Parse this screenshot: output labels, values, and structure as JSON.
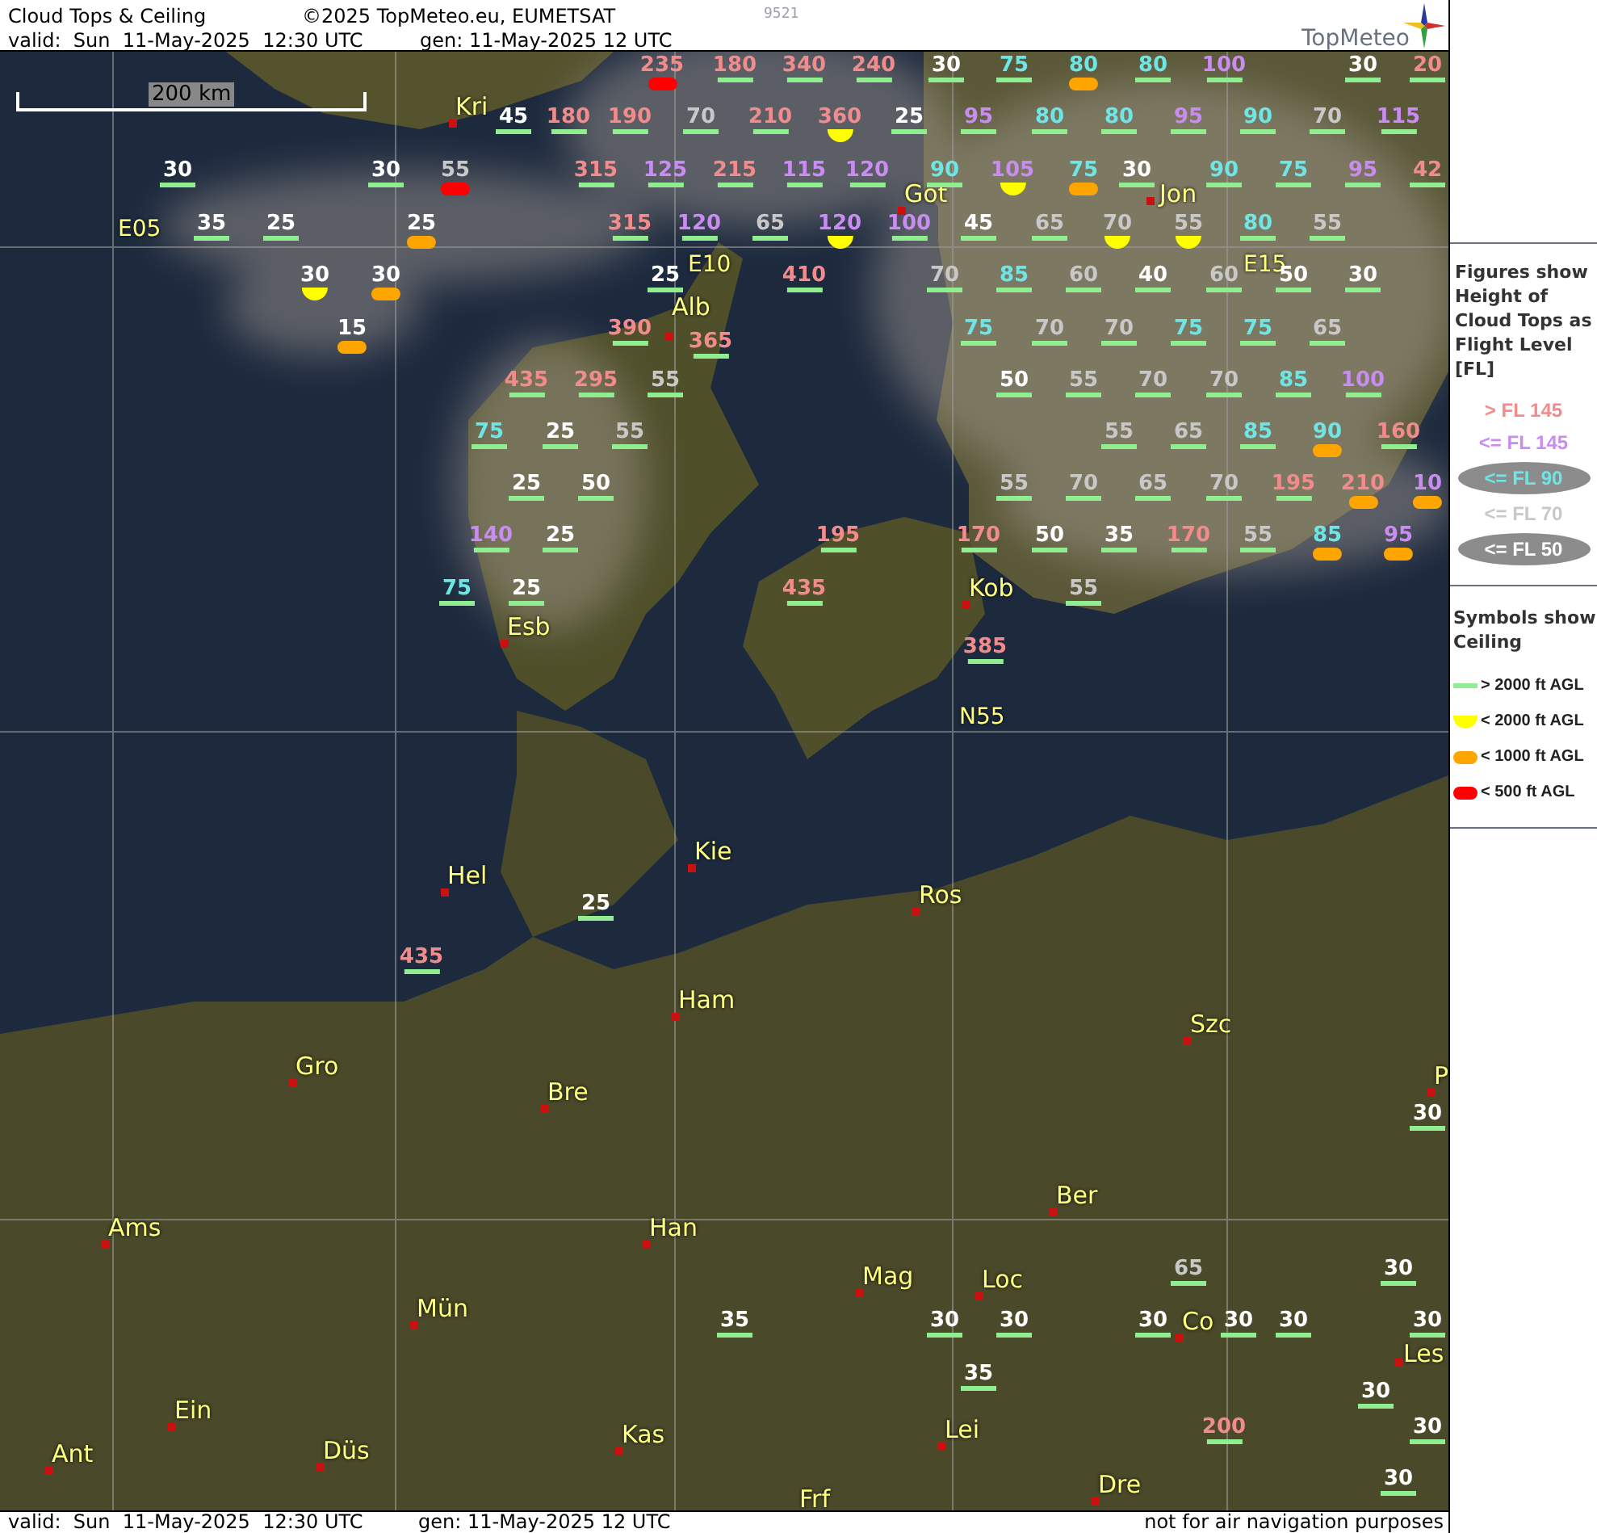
{
  "header": {
    "title": "Cloud Tops & Ceiling",
    "copyright": "©2025 TopMeteo.eu, EUMETSAT",
    "code": "9521",
    "valid": "valid:  Sun  11-May-2025  12:30 UTC",
    "generated": "gen: 11-May-2025 12 UTC",
    "logo": "TopMeteo"
  },
  "map": {
    "scale": "200 km",
    "grid_labels": [
      "E05",
      "E10",
      "E15",
      "N55"
    ],
    "cities": [
      "Kri",
      "Got",
      "Jon",
      "Alb",
      "Kob",
      "Esb",
      "Kie",
      "Hel",
      "Ros",
      "Ham",
      "Szc",
      "Gro",
      "Bre",
      "Ber",
      "Ams",
      "Han",
      "Mag",
      "Loc",
      "Mün",
      "Co",
      "Les",
      "Ein",
      "Lei",
      "Kas",
      "Ant",
      "Düs",
      "Dre",
      "Frf",
      "P"
    ],
    "cloud_tops": [
      {
        "value": "235",
        "color": "#f28c8c",
        "kind": "below500"
      },
      {
        "value": "180",
        "color": "#f28c8c",
        "kind": "above2000"
      },
      {
        "value": "340",
        "color": "#f28c8c",
        "kind": "above2000"
      },
      {
        "value": "240",
        "color": "#f28c8c",
        "kind": "above2000"
      },
      {
        "value": "30",
        "color": "#ffffff",
        "kind": "above2000"
      },
      {
        "value": "75",
        "color": "#6ee6e6",
        "kind": "above2000"
      },
      {
        "value": "80",
        "color": "#6ee6e6",
        "kind": "below1000"
      },
      {
        "value": "80",
        "color": "#6ee6e6",
        "kind": "above2000"
      },
      {
        "value": "100",
        "color": "#c98cf0",
        "kind": "above2000"
      },
      {
        "value": "30",
        "color": "#ffffff",
        "kind": "above2000"
      },
      {
        "value": "20",
        "color": "#f28c8c",
        "kind": "above2000"
      },
      {
        "value": "45",
        "color": "#ffffff",
        "kind": "above2000"
      },
      {
        "value": "180",
        "color": "#f28c8c",
        "kind": "above2000"
      },
      {
        "value": "190",
        "color": "#f28c8c",
        "kind": "above2000"
      },
      {
        "value": "70",
        "color": "#c8c8c8",
        "kind": "above2000"
      },
      {
        "value": "210",
        "color": "#f28c8c",
        "kind": "above2000"
      },
      {
        "value": "360",
        "color": "#f28c8c",
        "kind": "below2000"
      },
      {
        "value": "25",
        "color": "#ffffff",
        "kind": "above2000"
      },
      {
        "value": "95",
        "color": "#c98cf0",
        "kind": "above2000"
      },
      {
        "value": "80",
        "color": "#6ee6e6",
        "kind": "above2000"
      },
      {
        "value": "80",
        "color": "#6ee6e6",
        "kind": "above2000"
      },
      {
        "value": "95",
        "color": "#c98cf0",
        "kind": "above2000"
      },
      {
        "value": "90",
        "color": "#6ee6e6",
        "kind": "above2000"
      },
      {
        "value": "70",
        "color": "#c8c8c8",
        "kind": "above2000"
      },
      {
        "value": "115",
        "color": "#c98cf0",
        "kind": "above2000"
      },
      {
        "value": "30",
        "color": "#ffffff",
        "kind": "above2000"
      },
      {
        "value": "30",
        "color": "#ffffff",
        "kind": "above2000"
      },
      {
        "value": "55",
        "color": "#c8c8c8",
        "kind": "below500"
      },
      {
        "value": "315",
        "color": "#f28c8c",
        "kind": "above2000"
      },
      {
        "value": "125",
        "color": "#c98cf0",
        "kind": "above2000"
      },
      {
        "value": "215",
        "color": "#f28c8c",
        "kind": "above2000"
      },
      {
        "value": "115",
        "color": "#c98cf0",
        "kind": "above2000"
      },
      {
        "value": "120",
        "color": "#c98cf0",
        "kind": "above2000"
      },
      {
        "value": "90",
        "color": "#6ee6e6",
        "kind": "above2000"
      },
      {
        "value": "105",
        "color": "#c98cf0",
        "kind": "below2000"
      },
      {
        "value": "75",
        "color": "#6ee6e6",
        "kind": "below1000"
      },
      {
        "value": "30",
        "color": "#ffffff",
        "kind": "above2000"
      },
      {
        "value": "90",
        "color": "#6ee6e6",
        "kind": "above2000"
      },
      {
        "value": "75",
        "color": "#6ee6e6",
        "kind": "above2000"
      },
      {
        "value": "95",
        "color": "#c98cf0",
        "kind": "above2000"
      },
      {
        "value": "42",
        "color": "#f28c8c",
        "kind": "above2000"
      },
      {
        "value": "35",
        "color": "#ffffff",
        "kind": "above2000"
      },
      {
        "value": "25",
        "color": "#ffffff",
        "kind": "above2000"
      },
      {
        "value": "25",
        "color": "#ffffff",
        "kind": "below1000"
      },
      {
        "value": "315",
        "color": "#f28c8c",
        "kind": "above2000"
      },
      {
        "value": "120",
        "color": "#c98cf0",
        "kind": "above2000"
      },
      {
        "value": "65",
        "color": "#c8c8c8",
        "kind": "above2000"
      },
      {
        "value": "120",
        "color": "#c98cf0",
        "kind": "below2000"
      },
      {
        "value": "100",
        "color": "#c98cf0",
        "kind": "above2000"
      },
      {
        "value": "45",
        "color": "#ffffff",
        "kind": "above2000"
      },
      {
        "value": "65",
        "color": "#c8c8c8",
        "kind": "above2000"
      },
      {
        "value": "70",
        "color": "#c8c8c8",
        "kind": "below2000"
      },
      {
        "value": "55",
        "color": "#c8c8c8",
        "kind": "below2000"
      },
      {
        "value": "80",
        "color": "#6ee6e6",
        "kind": "above2000"
      },
      {
        "value": "55",
        "color": "#c8c8c8",
        "kind": "above2000"
      },
      {
        "value": "30",
        "color": "#ffffff",
        "kind": "below2000"
      },
      {
        "value": "30",
        "color": "#ffffff",
        "kind": "below1000"
      },
      {
        "value": "25",
        "color": "#ffffff",
        "kind": "above2000"
      },
      {
        "value": "410",
        "color": "#f28c8c",
        "kind": "above2000"
      },
      {
        "value": "70",
        "color": "#c8c8c8",
        "kind": "above2000"
      },
      {
        "value": "85",
        "color": "#6ee6e6",
        "kind": "above2000"
      },
      {
        "value": "60",
        "color": "#c8c8c8",
        "kind": "above2000"
      },
      {
        "value": "40",
        "color": "#ffffff",
        "kind": "above2000"
      },
      {
        "value": "60",
        "color": "#c8c8c8",
        "kind": "above2000"
      },
      {
        "value": "50",
        "color": "#ffffff",
        "kind": "above2000"
      },
      {
        "value": "30",
        "color": "#ffffff",
        "kind": "above2000"
      },
      {
        "value": "15",
        "color": "#ffffff",
        "kind": "below1000"
      },
      {
        "value": "390",
        "color": "#f28c8c",
        "kind": "above2000"
      },
      {
        "value": "365",
        "color": "#f28c8c",
        "kind": "above2000"
      },
      {
        "value": "75",
        "color": "#6ee6e6",
        "kind": "above2000"
      },
      {
        "value": "70",
        "color": "#c8c8c8",
        "kind": "above2000"
      },
      {
        "value": "70",
        "color": "#c8c8c8",
        "kind": "above2000"
      },
      {
        "value": "75",
        "color": "#6ee6e6",
        "kind": "above2000"
      },
      {
        "value": "75",
        "color": "#6ee6e6",
        "kind": "above2000"
      },
      {
        "value": "65",
        "color": "#c8c8c8",
        "kind": "above2000"
      },
      {
        "value": "435",
        "color": "#f28c8c",
        "kind": "above2000"
      },
      {
        "value": "295",
        "color": "#f28c8c",
        "kind": "above2000"
      },
      {
        "value": "55",
        "color": "#c8c8c8",
        "kind": "above2000"
      },
      {
        "value": "50",
        "color": "#ffffff",
        "kind": "above2000"
      },
      {
        "value": "55",
        "color": "#c8c8c8",
        "kind": "above2000"
      },
      {
        "value": "70",
        "color": "#c8c8c8",
        "kind": "above2000"
      },
      {
        "value": "70",
        "color": "#c8c8c8",
        "kind": "above2000"
      },
      {
        "value": "85",
        "color": "#6ee6e6",
        "kind": "above2000"
      },
      {
        "value": "100",
        "color": "#c98cf0",
        "kind": "above2000"
      },
      {
        "value": "75",
        "color": "#6ee6e6",
        "kind": "above2000"
      },
      {
        "value": "25",
        "color": "#ffffff",
        "kind": "above2000"
      },
      {
        "value": "55",
        "color": "#c8c8c8",
        "kind": "above2000"
      },
      {
        "value": "55",
        "color": "#c8c8c8",
        "kind": "above2000"
      },
      {
        "value": "65",
        "color": "#c8c8c8",
        "kind": "above2000"
      },
      {
        "value": "85",
        "color": "#6ee6e6",
        "kind": "above2000"
      },
      {
        "value": "90",
        "color": "#6ee6e6",
        "kind": "below1000"
      },
      {
        "value": "160",
        "color": "#f28c8c",
        "kind": "above2000"
      },
      {
        "value": "25",
        "color": "#ffffff",
        "kind": "above2000"
      },
      {
        "value": "50",
        "color": "#ffffff",
        "kind": "above2000"
      },
      {
        "value": "55",
        "color": "#c8c8c8",
        "kind": "above2000"
      },
      {
        "value": "70",
        "color": "#c8c8c8",
        "kind": "above2000"
      },
      {
        "value": "65",
        "color": "#c8c8c8",
        "kind": "above2000"
      },
      {
        "value": "70",
        "color": "#c8c8c8",
        "kind": "above2000"
      },
      {
        "value": "195",
        "color": "#f28c8c",
        "kind": "above2000"
      },
      {
        "value": "210",
        "color": "#f28c8c",
        "kind": "below1000"
      },
      {
        "value": "10",
        "color": "#c98cf0",
        "kind": "below1000"
      },
      {
        "value": "140",
        "color": "#c98cf0",
        "kind": "above2000"
      },
      {
        "value": "25",
        "color": "#ffffff",
        "kind": "above2000"
      },
      {
        "value": "195",
        "color": "#f28c8c",
        "kind": "above2000"
      },
      {
        "value": "170",
        "color": "#f28c8c",
        "kind": "above2000"
      },
      {
        "value": "50",
        "color": "#ffffff",
        "kind": "above2000"
      },
      {
        "value": "35",
        "color": "#ffffff",
        "kind": "above2000"
      },
      {
        "value": "170",
        "color": "#f28c8c",
        "kind": "above2000"
      },
      {
        "value": "55",
        "color": "#c8c8c8",
        "kind": "above2000"
      },
      {
        "value": "85",
        "color": "#6ee6e6",
        "kind": "below1000"
      },
      {
        "value": "95",
        "color": "#c98cf0",
        "kind": "below1000"
      },
      {
        "value": "75",
        "color": "#6ee6e6",
        "kind": "above2000"
      },
      {
        "value": "25",
        "color": "#ffffff",
        "kind": "above2000"
      },
      {
        "value": "435",
        "color": "#f28c8c",
        "kind": "above2000"
      },
      {
        "value": "55",
        "color": "#c8c8c8",
        "kind": "above2000"
      },
      {
        "value": "385",
        "color": "#f28c8c",
        "kind": "above2000"
      },
      {
        "value": "25",
        "color": "#ffffff",
        "kind": "above2000"
      },
      {
        "value": "435",
        "color": "#f28c8c",
        "kind": "above2000"
      },
      {
        "value": "30",
        "color": "#ffffff",
        "kind": "above2000"
      },
      {
        "value": "65",
        "color": "#c8c8c8",
        "kind": "above2000"
      },
      {
        "value": "30",
        "color": "#ffffff",
        "kind": "above2000"
      },
      {
        "value": "35",
        "color": "#ffffff",
        "kind": "above2000"
      },
      {
        "value": "30",
        "color": "#ffffff",
        "kind": "above2000"
      },
      {
        "value": "30",
        "color": "#ffffff",
        "kind": "above2000"
      },
      {
        "value": "30",
        "color": "#ffffff",
        "kind": "above2000"
      },
      {
        "value": "30",
        "color": "#ffffff",
        "kind": "above2000"
      },
      {
        "value": "30",
        "color": "#ffffff",
        "kind": "above2000"
      },
      {
        "value": "30",
        "color": "#ffffff",
        "kind": "above2000"
      },
      {
        "value": "35",
        "color": "#ffffff",
        "kind": "above2000"
      },
      {
        "value": "30",
        "color": "#ffffff",
        "kind": "above2000"
      },
      {
        "value": "200",
        "color": "#f28c8c",
        "kind": "above2000"
      },
      {
        "value": "30",
        "color": "#ffffff",
        "kind": "above2000"
      },
      {
        "value": "30",
        "color": "#ffffff",
        "kind": "above2000"
      }
    ]
  },
  "legend": {
    "figures_title": "Figures show Height of Cloud Tops as Flight Level  [FL]",
    "flight_levels": [
      {
        "label": "> FL 145",
        "color": "#f28c8c",
        "kind": "plain"
      },
      {
        "label": "<= FL 145",
        "color": "#c98cf0",
        "kind": "plain"
      },
      {
        "label": "<= FL 90",
        "color": "#6ee6e6",
        "kind": "pill"
      },
      {
        "label": "<= FL 70",
        "color": "#c8c8c8",
        "kind": "plain"
      },
      {
        "label": "<= FL 50",
        "color": "#ffffff",
        "kind": "pill"
      }
    ],
    "symbols_title": "Symbols show Ceiling",
    "ceilings": [
      {
        "label": "> 2000 ft AGL",
        "kind": "above2000"
      },
      {
        "label": "< 2000 ft AGL",
        "kind": "below2000"
      },
      {
        "label": "< 1000 ft AGL",
        "kind": "below1000"
      },
      {
        "label": "< 500 ft AGL",
        "kind": "below500"
      }
    ]
  },
  "footer": {
    "valid": "valid:  Sun  11-May-2025  12:30 UTC",
    "generated": "gen: 11-May-2025 12 UTC",
    "disclaimer": "not for air navigation purposes"
  }
}
